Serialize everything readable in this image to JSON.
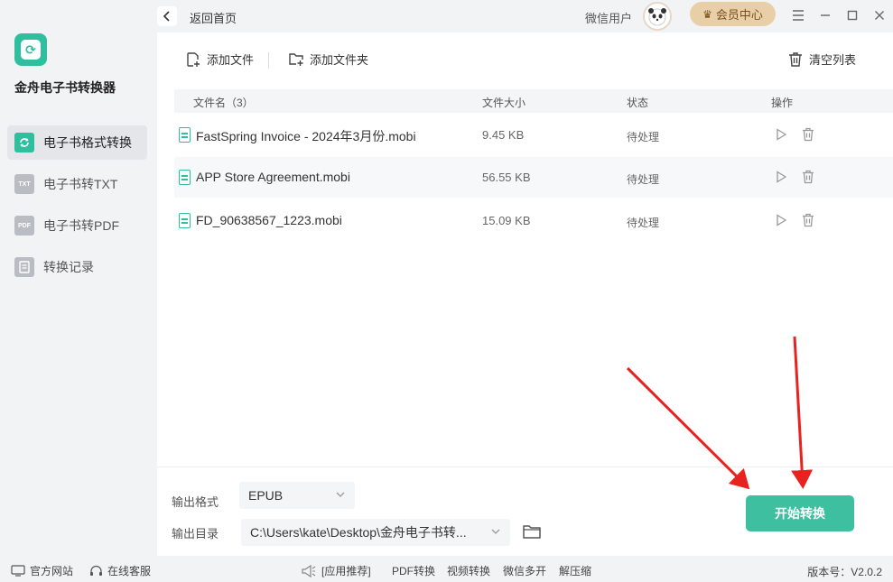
{
  "app": {
    "name": "金舟电子书转换器",
    "version_label": "版本号：",
    "version": "V2.0.2"
  },
  "topbar": {
    "back_label": "返回首页",
    "user_name": "微信用户",
    "vip_label": "会员中心"
  },
  "sidebar": {
    "items": [
      {
        "label": "电子书格式转换",
        "icon_text": "",
        "icon": "convert-icon",
        "active": true
      },
      {
        "label": "电子书转TXT",
        "icon_text": "TXT",
        "icon": "txt-icon",
        "active": false
      },
      {
        "label": "电子书转PDF",
        "icon_text": "PDF",
        "icon": "pdf-icon",
        "active": false
      },
      {
        "label": "转换记录",
        "icon_text": "",
        "icon": "history-icon",
        "active": false
      }
    ]
  },
  "toolbar": {
    "add_file": "添加文件",
    "add_folder": "添加文件夹",
    "clear_list": "清空列表"
  },
  "table": {
    "headers": {
      "name": "文件名（3）",
      "size": "文件大小",
      "status": "状态",
      "actions": "操作"
    },
    "rows": [
      {
        "name": "FastSpring Invoice - 2024年3月份.mobi",
        "size": "9.45 KB",
        "status": "待处理"
      },
      {
        "name": "APP Store Agreement.mobi",
        "size": "56.55 KB",
        "status": "待处理"
      },
      {
        "name": "FD_90638567_1223.mobi",
        "size": "15.09 KB",
        "status": "待处理"
      }
    ]
  },
  "output": {
    "format_label": "输出格式",
    "format_value": "EPUB",
    "dir_label": "输出目录",
    "dir_value": "C:\\Users\\kate\\Desktop\\金舟电子书转..."
  },
  "start_button": "开始转换",
  "statusbar": {
    "website": "官方网站",
    "support": "在线客服",
    "recommend": "[应用推荐]",
    "links": [
      "PDF转换",
      "视频转换",
      "微信多开",
      "解压缩"
    ]
  },
  "colors": {
    "accent": "#2fbf9e",
    "start_button": "#3dbfa0",
    "vip_bg": "#e9cfa8",
    "arrow": "#e8231f"
  }
}
